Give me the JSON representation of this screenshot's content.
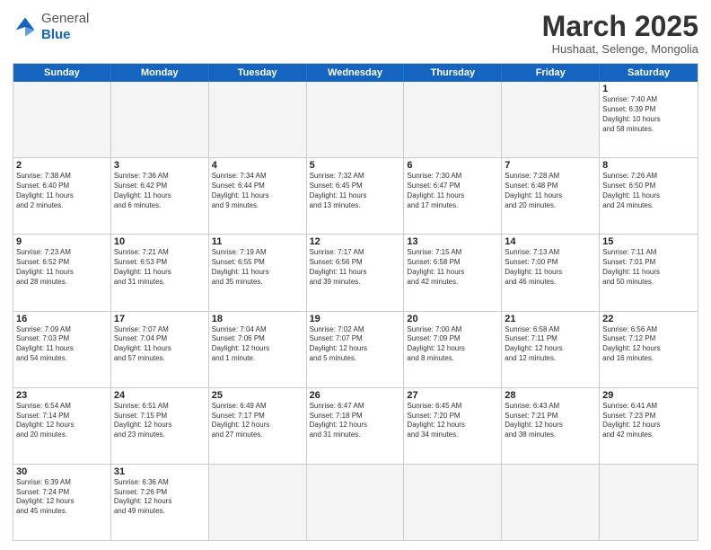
{
  "header": {
    "logo_general": "General",
    "logo_blue": "Blue",
    "month_year": "March 2025",
    "location": "Hushaat, Selenge, Mongolia"
  },
  "weekdays": [
    "Sunday",
    "Monday",
    "Tuesday",
    "Wednesday",
    "Thursday",
    "Friday",
    "Saturday"
  ],
  "rows": [
    [
      {
        "day": "",
        "info": "",
        "empty": true
      },
      {
        "day": "",
        "info": "",
        "empty": true
      },
      {
        "day": "",
        "info": "",
        "empty": true
      },
      {
        "day": "",
        "info": "",
        "empty": true
      },
      {
        "day": "",
        "info": "",
        "empty": true
      },
      {
        "day": "",
        "info": "",
        "empty": true
      },
      {
        "day": "1",
        "info": "Sunrise: 7:40 AM\nSunset: 6:39 PM\nDaylight: 10 hours\nand 58 minutes.",
        "empty": false
      }
    ],
    [
      {
        "day": "2",
        "info": "Sunrise: 7:38 AM\nSunset: 6:40 PM\nDaylight: 11 hours\nand 2 minutes.",
        "empty": false
      },
      {
        "day": "3",
        "info": "Sunrise: 7:36 AM\nSunset: 6:42 PM\nDaylight: 11 hours\nand 6 minutes.",
        "empty": false
      },
      {
        "day": "4",
        "info": "Sunrise: 7:34 AM\nSunset: 6:44 PM\nDaylight: 11 hours\nand 9 minutes.",
        "empty": false
      },
      {
        "day": "5",
        "info": "Sunrise: 7:32 AM\nSunset: 6:45 PM\nDaylight: 11 hours\nand 13 minutes.",
        "empty": false
      },
      {
        "day": "6",
        "info": "Sunrise: 7:30 AM\nSunset: 6:47 PM\nDaylight: 11 hours\nand 17 minutes.",
        "empty": false
      },
      {
        "day": "7",
        "info": "Sunrise: 7:28 AM\nSunset: 6:48 PM\nDaylight: 11 hours\nand 20 minutes.",
        "empty": false
      },
      {
        "day": "8",
        "info": "Sunrise: 7:26 AM\nSunset: 6:50 PM\nDaylight: 11 hours\nand 24 minutes.",
        "empty": false
      }
    ],
    [
      {
        "day": "9",
        "info": "Sunrise: 7:23 AM\nSunset: 6:52 PM\nDaylight: 11 hours\nand 28 minutes.",
        "empty": false
      },
      {
        "day": "10",
        "info": "Sunrise: 7:21 AM\nSunset: 6:53 PM\nDaylight: 11 hours\nand 31 minutes.",
        "empty": false
      },
      {
        "day": "11",
        "info": "Sunrise: 7:19 AM\nSunset: 6:55 PM\nDaylight: 11 hours\nand 35 minutes.",
        "empty": false
      },
      {
        "day": "12",
        "info": "Sunrise: 7:17 AM\nSunset: 6:56 PM\nDaylight: 11 hours\nand 39 minutes.",
        "empty": false
      },
      {
        "day": "13",
        "info": "Sunrise: 7:15 AM\nSunset: 6:58 PM\nDaylight: 11 hours\nand 42 minutes.",
        "empty": false
      },
      {
        "day": "14",
        "info": "Sunrise: 7:13 AM\nSunset: 7:00 PM\nDaylight: 11 hours\nand 46 minutes.",
        "empty": false
      },
      {
        "day": "15",
        "info": "Sunrise: 7:11 AM\nSunset: 7:01 PM\nDaylight: 11 hours\nand 50 minutes.",
        "empty": false
      }
    ],
    [
      {
        "day": "16",
        "info": "Sunrise: 7:09 AM\nSunset: 7:03 PM\nDaylight: 11 hours\nand 54 minutes.",
        "empty": false
      },
      {
        "day": "17",
        "info": "Sunrise: 7:07 AM\nSunset: 7:04 PM\nDaylight: 11 hours\nand 57 minutes.",
        "empty": false
      },
      {
        "day": "18",
        "info": "Sunrise: 7:04 AM\nSunset: 7:06 PM\nDaylight: 12 hours\nand 1 minute.",
        "empty": false
      },
      {
        "day": "19",
        "info": "Sunrise: 7:02 AM\nSunset: 7:07 PM\nDaylight: 12 hours\nand 5 minutes.",
        "empty": false
      },
      {
        "day": "20",
        "info": "Sunrise: 7:00 AM\nSunset: 7:09 PM\nDaylight: 12 hours\nand 8 minutes.",
        "empty": false
      },
      {
        "day": "21",
        "info": "Sunrise: 6:58 AM\nSunset: 7:11 PM\nDaylight: 12 hours\nand 12 minutes.",
        "empty": false
      },
      {
        "day": "22",
        "info": "Sunrise: 6:56 AM\nSunset: 7:12 PM\nDaylight: 12 hours\nand 16 minutes.",
        "empty": false
      }
    ],
    [
      {
        "day": "23",
        "info": "Sunrise: 6:54 AM\nSunset: 7:14 PM\nDaylight: 12 hours\nand 20 minutes.",
        "empty": false
      },
      {
        "day": "24",
        "info": "Sunrise: 6:51 AM\nSunset: 7:15 PM\nDaylight: 12 hours\nand 23 minutes.",
        "empty": false
      },
      {
        "day": "25",
        "info": "Sunrise: 6:49 AM\nSunset: 7:17 PM\nDaylight: 12 hours\nand 27 minutes.",
        "empty": false
      },
      {
        "day": "26",
        "info": "Sunrise: 6:47 AM\nSunset: 7:18 PM\nDaylight: 12 hours\nand 31 minutes.",
        "empty": false
      },
      {
        "day": "27",
        "info": "Sunrise: 6:45 AM\nSunset: 7:20 PM\nDaylight: 12 hours\nand 34 minutes.",
        "empty": false
      },
      {
        "day": "28",
        "info": "Sunrise: 6:43 AM\nSunset: 7:21 PM\nDaylight: 12 hours\nand 38 minutes.",
        "empty": false
      },
      {
        "day": "29",
        "info": "Sunrise: 6:41 AM\nSunset: 7:23 PM\nDaylight: 12 hours\nand 42 minutes.",
        "empty": false
      }
    ],
    [
      {
        "day": "30",
        "info": "Sunrise: 6:39 AM\nSunset: 7:24 PM\nDaylight: 12 hours\nand 45 minutes.",
        "empty": false
      },
      {
        "day": "31",
        "info": "Sunrise: 6:36 AM\nSunset: 7:26 PM\nDaylight: 12 hours\nand 49 minutes.",
        "empty": false
      },
      {
        "day": "",
        "info": "",
        "empty": true
      },
      {
        "day": "",
        "info": "",
        "empty": true
      },
      {
        "day": "",
        "info": "",
        "empty": true
      },
      {
        "day": "",
        "info": "",
        "empty": true
      },
      {
        "day": "",
        "info": "",
        "empty": true
      }
    ]
  ]
}
